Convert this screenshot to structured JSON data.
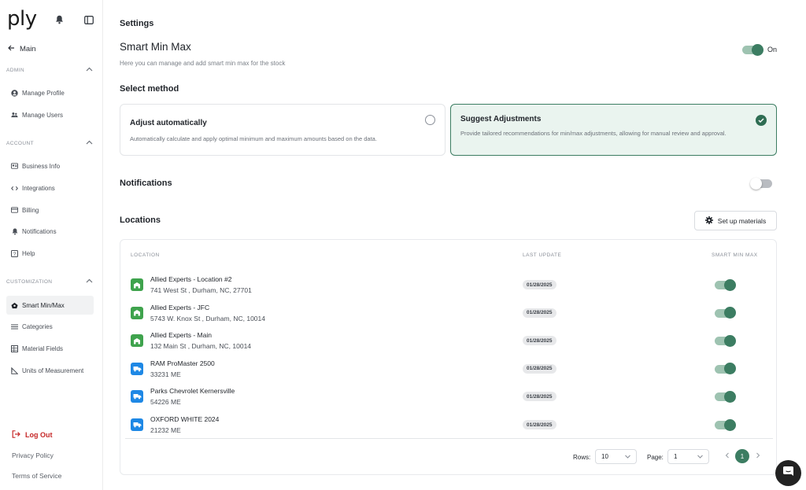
{
  "brand": {
    "logo_text": "ply"
  },
  "sidebar": {
    "main_link": "Main",
    "sections": [
      {
        "title": "ADMIN",
        "items": [
          {
            "label": "Manage Profile",
            "icon": "user-circle-icon"
          },
          {
            "label": "Manage Users",
            "icon": "users-icon"
          }
        ]
      },
      {
        "title": "ACCOUNT",
        "items": [
          {
            "label": "Business Info",
            "icon": "id-card-icon"
          },
          {
            "label": "Integrations",
            "icon": "code-icon"
          },
          {
            "label": "Billing",
            "icon": "credit-card-icon"
          },
          {
            "label": "Notifications",
            "icon": "bell-icon"
          },
          {
            "label": "Help",
            "icon": "help-icon"
          }
        ]
      },
      {
        "title": "CUSTOMIZATION",
        "items": [
          {
            "label": "Smart Min/Max",
            "icon": "smart-icon",
            "active": true
          },
          {
            "label": "Categories",
            "icon": "list-icon"
          },
          {
            "label": "Material Fields",
            "icon": "grid-icon"
          },
          {
            "label": "Units of Measurement",
            "icon": "ruler-icon"
          }
        ]
      }
    ],
    "logout": "Log Out",
    "privacy": "Privacy Policy",
    "terms": "Terms of Service"
  },
  "page": {
    "settings_title": "Settings",
    "smart_title": "Smart Min Max",
    "smart_subtitle": "Here you can manage and add smart min max for the stock",
    "smart_toggle_label": "On",
    "smart_enabled": true,
    "method_title": "Select method",
    "methods": [
      {
        "title": "Adjust automatically",
        "desc": "Automatically calculate and apply optimal minimum and maximum amounts based on the data.",
        "selected": false
      },
      {
        "title": "Suggest Adjustments",
        "desc": "Provide tailored recommendations for min/max adjustments, allowing for manual review and approval.",
        "selected": true
      }
    ],
    "notifications_title": "Notifications",
    "notifications_enabled": false,
    "locations_title": "Locations",
    "setup_button": "Set up materials"
  },
  "table": {
    "headers": {
      "location": "LOCATION",
      "last_update": "LAST UPDATE",
      "smart": "SMART MIN MAX"
    },
    "rows": [
      {
        "name": "Allied Experts - Location #2",
        "address": "741 West St , Durham, NC, 27701",
        "date": "01/28/2025",
        "type": "building",
        "enabled": true
      },
      {
        "name": "Allied Experts - JFC",
        "address": "5743 W. Knox St , Durham, NC, 10014",
        "date": "01/28/2025",
        "type": "building",
        "enabled": true
      },
      {
        "name": "Allied Experts - Main",
        "address": "132 Main St , Durham, NC, 10014",
        "date": "01/28/2025",
        "type": "building",
        "enabled": true
      },
      {
        "name": "RAM ProMaster 2500",
        "address": "33231 ME",
        "date": "01/28/2025",
        "type": "truck",
        "enabled": true
      },
      {
        "name": "Parks Chevrolet Kernersville",
        "address": "54226 ME",
        "date": "01/28/2025",
        "type": "truck",
        "enabled": true
      },
      {
        "name": "OXFORD WHITE 2024",
        "address": "21232 ME",
        "date": "01/28/2025",
        "type": "truck",
        "enabled": true
      }
    ],
    "pagination": {
      "rows_label": "Rows:",
      "rows_value": "10",
      "page_label": "Page:",
      "page_value": "1",
      "current_page": "1"
    }
  },
  "colors": {
    "accent": "#3c7d62",
    "building": "#3fa34d",
    "truck": "#1e88e5",
    "logout": "#c62828"
  }
}
